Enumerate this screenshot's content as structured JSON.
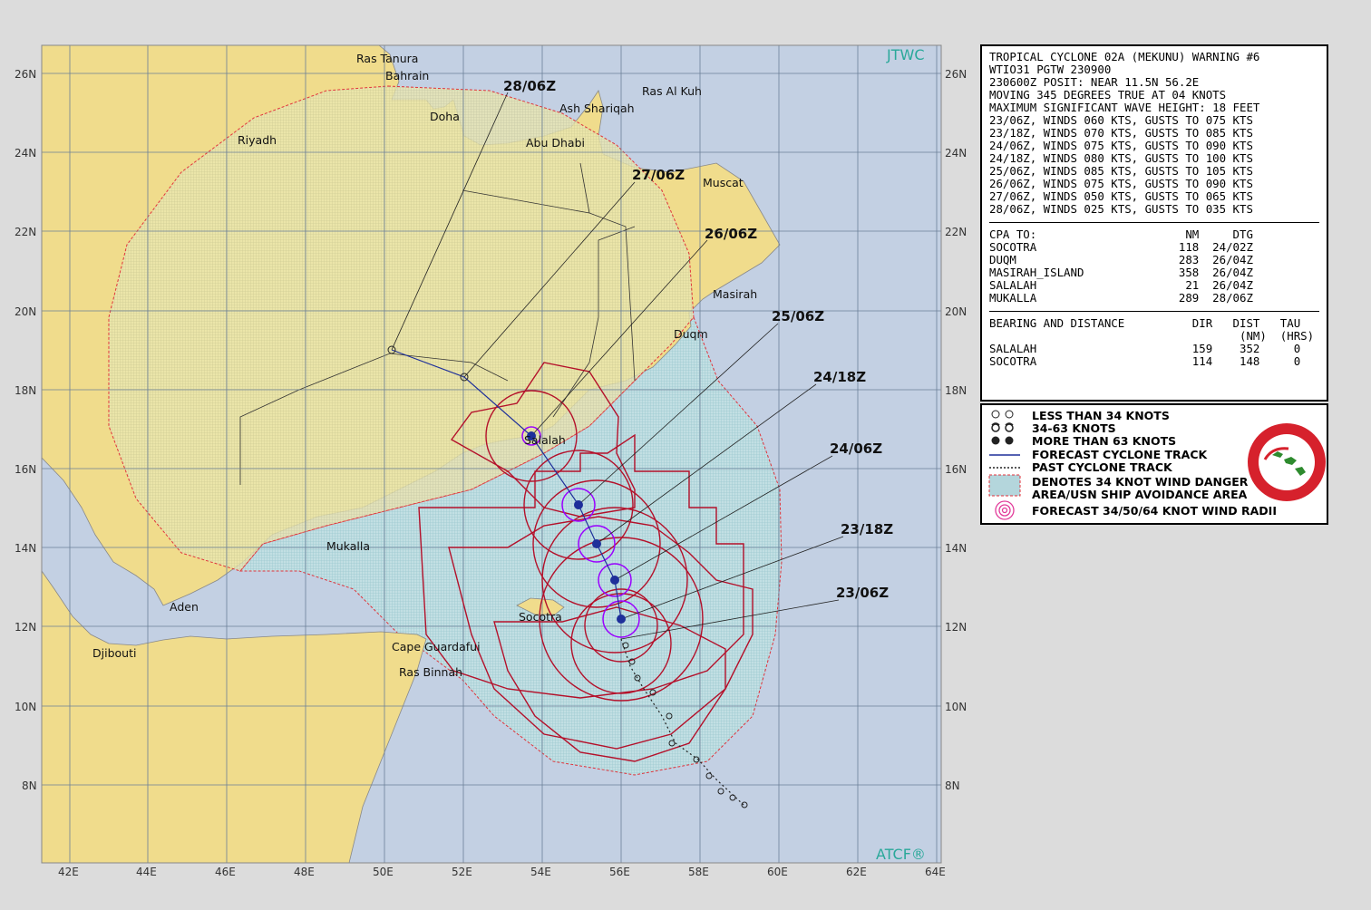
{
  "map": {
    "agency_label": "JTWC",
    "software_label": "ATCF®",
    "lat_labels": [
      "26N",
      "24N",
      "22N",
      "20N",
      "18N",
      "16N",
      "14N",
      "12N",
      "10N",
      "8N"
    ],
    "lon_labels": [
      "42E",
      "44E",
      "46E",
      "48E",
      "50E",
      "52E",
      "54E",
      "56E",
      "58E",
      "60E",
      "62E",
      "64E"
    ],
    "places": [
      {
        "name": "Ras Tanura"
      },
      {
        "name": "Bahrain"
      },
      {
        "name": "Doha"
      },
      {
        "name": "Ras Al Kuh"
      },
      {
        "name": "Ash Shariqah"
      },
      {
        "name": "Abu Dhabi"
      },
      {
        "name": "Riyadh"
      },
      {
        "name": "Muscat"
      },
      {
        "name": "Masirah"
      },
      {
        "name": "Duqm"
      },
      {
        "name": "Salalah"
      },
      {
        "name": "Mukalla"
      },
      {
        "name": "Aden"
      },
      {
        "name": "Socotra"
      },
      {
        "name": "Djibouti"
      },
      {
        "name": "Cape Guardafui"
      },
      {
        "name": "Ras Binnah"
      }
    ],
    "forecast_labels": [
      "28/06Z",
      "27/06Z",
      "26/06Z",
      "25/06Z",
      "24/18Z",
      "24/06Z",
      "23/18Z",
      "23/06Z"
    ],
    "colors": {
      "land": "#f0dc8c",
      "sea": "#c3d0e3",
      "danger": "#b4d6dc",
      "radii": "#b4102a",
      "wind50": "#9a00ff",
      "track": "#1e2f9a"
    }
  },
  "warning": {
    "header": [
      "TROPICAL CYCLONE 02A (MEKUNU) WARNING #6",
      "WTIO31 PGTW 230900",
      "230600Z POSIT: NEAR 11.5N 56.2E",
      "MOVING 345 DEGREES TRUE AT 04 KNOTS",
      "MAXIMUM SIGNIFICANT WAVE HEIGHT: 18 FEET",
      "23/06Z, WINDS 060 KTS, GUSTS TO 075 KTS",
      "23/18Z, WINDS 070 KTS, GUSTS TO 085 KTS",
      "24/06Z, WINDS 075 KTS, GUSTS TO 090 KTS",
      "24/18Z, WINDS 080 KTS, GUSTS TO 100 KTS",
      "25/06Z, WINDS 085 KTS, GUSTS TO 105 KTS",
      "26/06Z, WINDS 075 KTS, GUSTS TO 090 KTS",
      "27/06Z, WINDS 050 KTS, GUSTS TO 065 KTS",
      "28/06Z, WINDS 025 KTS, GUSTS TO 035 KTS"
    ],
    "cpa": [
      "CPA TO:                      NM     DTG",
      "SOCOTRA                     118  24/02Z",
      "DUQM                        283  26/04Z",
      "MASIRAH_ISLAND              358  26/04Z",
      "SALALAH                      21  26/04Z",
      "MUKALLA                     289  28/06Z"
    ],
    "bearing": [
      "BEARING AND DISTANCE          DIR   DIST   TAU",
      "                                     (NM)  (HRS)",
      "SALALAH                       159    352     0",
      "SOCOTRA                       114    148     0"
    ]
  },
  "legend": {
    "less34": "LESS THAN 34 KNOTS",
    "k34_63": "34-63 KNOTS",
    "more63": "MORE THAN 63 KNOTS",
    "fc_track": "FORECAST CYCLONE TRACK",
    "past_track": "PAST CYCLONE TRACK",
    "danger_1": "DENOTES 34 KNOT WIND DANGER",
    "danger_2": "AREA/USN SHIP AVOIDANCE AREA",
    "radii": "FORECAST 34/50/64 KNOT WIND RADII",
    "seal_text": "JOINT TYPHOON WARNING CENTER",
    "seal_sub": "PEARL HARBOR HAWAII"
  }
}
